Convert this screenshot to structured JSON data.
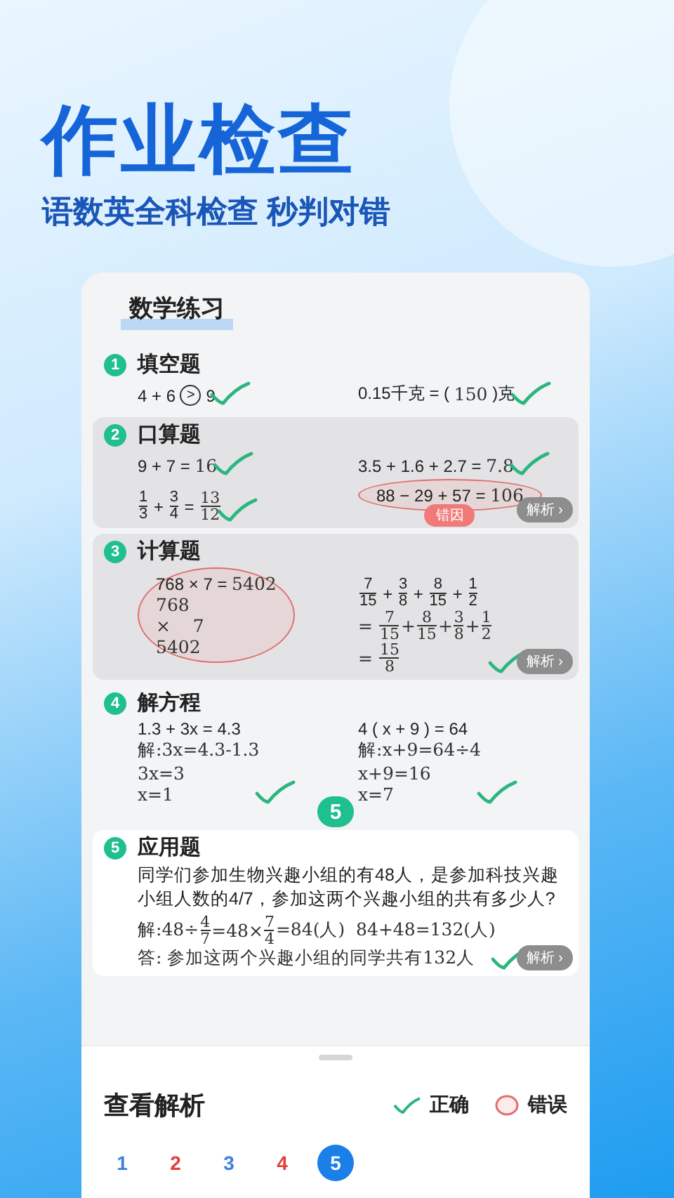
{
  "headline": "作业检查",
  "subtitle": "语数英全科检查 秒判对错",
  "worksheet": {
    "title": "数学练习",
    "sections": [
      {
        "number": "1",
        "title": "填空题",
        "items": [
          {
            "correct": true,
            "lines": [
              [
                {
                  "kind": "text",
                  "text": "4 + 6 "
                },
                {
                  "kind": "circ",
                  "text": ">"
                },
                {
                  "kind": "text",
                  "text": " 9"
                }
              ]
            ]
          },
          {
            "correct": true,
            "lines": [
              [
                {
                  "kind": "text",
                  "text": "0.15千克 = ( "
                },
                {
                  "kind": "hand",
                  "text": "150"
                },
                {
                  "kind": "text",
                  "text": " )克"
                }
              ]
            ]
          }
        ]
      },
      {
        "number": "2",
        "title": "口算题",
        "shaded": true,
        "analysis": "解析 ›",
        "items": [
          {
            "correct": true,
            "lines": [
              [
                {
                  "kind": "text",
                  "text": "9 + 7 = "
                },
                {
                  "kind": "hand",
                  "text": "16"
                }
              ]
            ]
          },
          {
            "correct": true,
            "lines": [
              [
                {
                  "kind": "text",
                  "text": "3.5 + 1.6 + 2.7 = "
                },
                {
                  "kind": "hand",
                  "text": "7.8"
                }
              ]
            ]
          },
          {
            "correct": true,
            "lines": [
              [
                {
                  "kind": "frac",
                  "num": "1",
                  "den": "3"
                },
                {
                  "kind": "text",
                  "text": " + "
                },
                {
                  "kind": "frac",
                  "num": "3",
                  "den": "4"
                },
                {
                  "kind": "text",
                  "text": " = "
                },
                {
                  "kind": "hfrac",
                  "num": "13",
                  "den": "12"
                }
              ]
            ]
          },
          {
            "correct": false,
            "tag": "错因",
            "lines": [
              [
                {
                  "kind": "text",
                  "text": "88 − 29 + 57 = "
                },
                {
                  "kind": "hand",
                  "text": "106"
                }
              ]
            ]
          }
        ]
      },
      {
        "number": "3",
        "title": "计算题",
        "shaded": true,
        "analysis": "解析 ›",
        "items": [
          {
            "correct": false,
            "lines": [
              [
                {
                  "kind": "text",
                  "text": "768 × 7 = "
                },
                {
                  "kind": "hand",
                  "text": "5402"
                }
              ],
              [
                {
                  "kind": "hand",
                  "text": "768"
                }
              ],
              [
                {
                  "kind": "hand",
                  "text": "×    7"
                }
              ],
              [
                {
                  "kind": "hand",
                  "text": "5402"
                }
              ]
            ]
          },
          {
            "correct": true,
            "lines": [
              [
                {
                  "kind": "frac",
                  "num": "7",
                  "den": "15"
                },
                {
                  "kind": "text",
                  "text": " + "
                },
                {
                  "kind": "frac",
                  "num": "3",
                  "den": "8"
                },
                {
                  "kind": "text",
                  "text": " + "
                },
                {
                  "kind": "frac",
                  "num": "8",
                  "den": "15"
                },
                {
                  "kind": "text",
                  "text": " + "
                },
                {
                  "kind": "frac",
                  "num": "1",
                  "den": "2"
                }
              ],
              [
                {
                  "kind": "hand",
                  "text": "= "
                },
                {
                  "kind": "hfrac",
                  "num": "7",
                  "den": "15"
                },
                {
                  "kind": "hand",
                  "text": "+"
                },
                {
                  "kind": "hfrac",
                  "num": "8",
                  "den": "15"
                },
                {
                  "kind": "hand",
                  "text": "+"
                },
                {
                  "kind": "hfrac",
                  "num": "3",
                  "den": "8"
                },
                {
                  "kind": "hand",
                  "text": "+"
                },
                {
                  "kind": "hfrac",
                  "num": "1",
                  "den": "2"
                }
              ],
              [
                {
                  "kind": "hand",
                  "text": "= "
                },
                {
                  "kind": "hfrac",
                  "num": "15",
                  "den": "8"
                }
              ]
            ]
          }
        ]
      },
      {
        "number": "4",
        "title": "解方程",
        "items": [
          {
            "correct": true,
            "lines": [
              [
                {
                  "kind": "text",
                  "text": "1.3 + 3x = 4.3"
                }
              ],
              [
                {
                  "kind": "hand",
                  "text": "解:3x=4.3-1.3"
                }
              ],
              [
                {
                  "kind": "hand",
                  "text": "3x=3"
                }
              ],
              [
                {
                  "kind": "hand",
                  "text": "x=1"
                }
              ]
            ]
          },
          {
            "correct": true,
            "lines": [
              [
                {
                  "kind": "text",
                  "text": "4 ( x + 9 ) = 64"
                }
              ],
              [
                {
                  "kind": "hand",
                  "text": "解:x+9=64÷4"
                }
              ],
              [
                {
                  "kind": "hand",
                  "text": "x+9=16"
                }
              ],
              [
                {
                  "kind": "hand",
                  "text": "x=7"
                }
              ]
            ]
          }
        ]
      },
      {
        "number": "5",
        "title": "应用题",
        "raised": true,
        "bubble": "5",
        "analysis": "解析 ›",
        "problem": "同学们参加生物兴趣小组的有48人，是参加科技兴趣小组人数的4/7，参加这两个兴趣小组的共有多少人?",
        "items": [
          {
            "correct": true,
            "lines": [
              [
                {
                  "kind": "hand",
                  "text": "解:48÷"
                },
                {
                  "kind": "hfrac",
                  "num": "4",
                  "den": "7"
                },
                {
                  "kind": "hand",
                  "text": "=48×"
                },
                {
                  "kind": "hfrac",
                  "num": "7",
                  "den": "4"
                },
                {
                  "kind": "hand",
                  "text": "=84(人)  84+48=132(人)"
                }
              ],
              [
                {
                  "kind": "hand",
                  "text": "答: 参加这两个兴趣小组的同学共有132人"
                }
              ]
            ]
          }
        ]
      }
    ]
  },
  "results": {
    "title": "查看解析",
    "legend": [
      {
        "kind": "correct",
        "label": "正确"
      },
      {
        "kind": "wrong",
        "label": "错误"
      }
    ],
    "questions": [
      {
        "label": "1",
        "correct": true,
        "selected": false
      },
      {
        "label": "2",
        "correct": false,
        "selected": false
      },
      {
        "label": "3",
        "correct": true,
        "selected": false
      },
      {
        "label": "4",
        "correct": false,
        "selected": false
      },
      {
        "label": "5",
        "correct": true,
        "selected": true
      }
    ]
  }
}
